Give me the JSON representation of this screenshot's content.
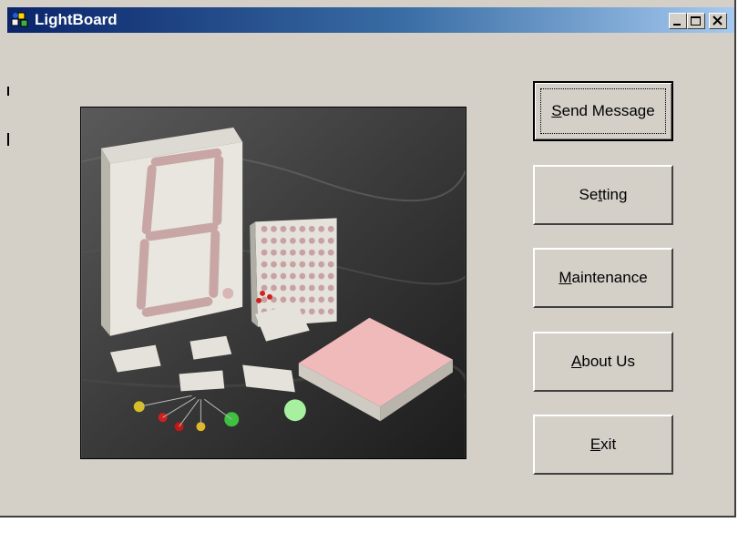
{
  "window": {
    "title": "LightBoard",
    "controls": {
      "minimize_icon": "minimize-icon",
      "maximize_icon": "maximize-icon",
      "close_icon": "close-icon"
    }
  },
  "main": {
    "image_alt": "LED display components photo",
    "buttons": [
      {
        "label": "Send Message",
        "mnemonic": "S",
        "default": true
      },
      {
        "label": "Setting",
        "mnemonic": "t",
        "default": false
      },
      {
        "label": "Maintenance",
        "mnemonic": "M",
        "default": false
      },
      {
        "label": "About Us",
        "mnemonic": "A",
        "default": false
      },
      {
        "label": "Exit",
        "mnemonic": "E",
        "default": false
      }
    ]
  },
  "colors": {
    "face": "#d4d0c8",
    "title_start": "#0a246a",
    "title_end": "#a6caf0"
  }
}
